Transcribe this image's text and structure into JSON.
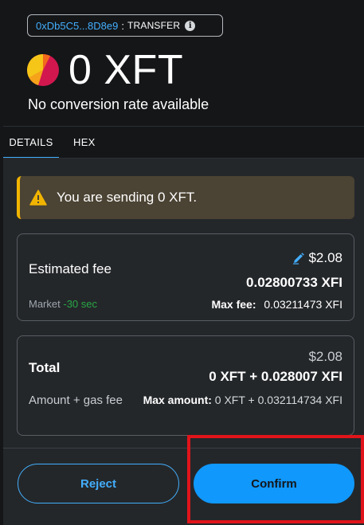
{
  "header": {
    "address": "0xDb5C5...8D8e9",
    "separator": ":",
    "method": "TRANSFER",
    "info_icon": "info-icon",
    "token_icon": "token-pie-icon",
    "amount": "0 XFT",
    "conversion": "No conversion rate available"
  },
  "tabs": [
    {
      "label": "DETAILS",
      "active": true
    },
    {
      "label": "HEX",
      "active": false
    }
  ],
  "alert": {
    "icon": "warning-icon",
    "text": "You are sending 0 XFT."
  },
  "fee": {
    "label": "Estimated fee",
    "edit_icon": "pencil-icon",
    "usd": "$2.08",
    "amount": "0.02800733 XFI",
    "market_label": "Market",
    "market_time": "-30 sec",
    "max_fee_label": "Max fee:",
    "max_fee_value": "0.03211473 XFI"
  },
  "total": {
    "label": "Total",
    "usd": "$2.08",
    "amount": "0 XFT + 0.028007 XFI",
    "sub_label": "Amount + gas fee",
    "max_amount_label": "Max amount:",
    "max_amount_value": "0 XFT + 0.032114734 XFI"
  },
  "buttons": {
    "reject": "Reject",
    "confirm": "Confirm"
  },
  "colors": {
    "accent": "#43aefc",
    "confirm_bg": "#1098fc",
    "warning": "#f0b400",
    "success": "#28a745",
    "highlight": "#e0141a"
  }
}
